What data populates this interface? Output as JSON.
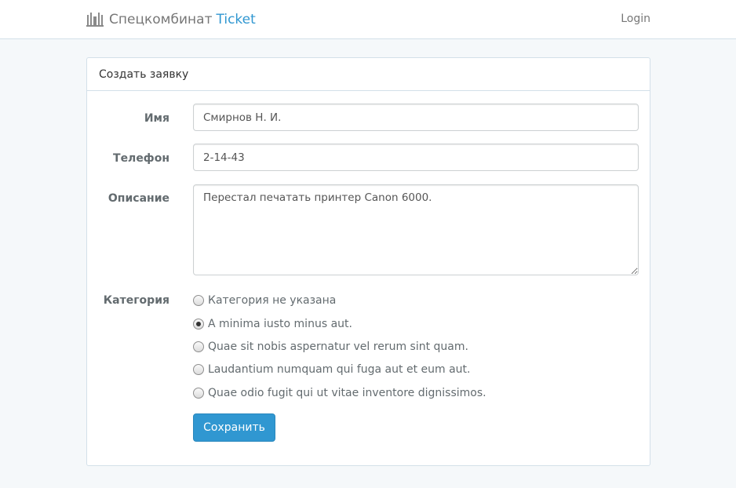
{
  "navbar": {
    "brand_name": "Спецкомбинат",
    "brand_accent": "Ticket",
    "logo_icon": "building-columns-icon",
    "login_label": "Login"
  },
  "panel": {
    "heading": "Создать заявку"
  },
  "form": {
    "name": {
      "label": "Имя",
      "value": "Смирнов Н. И."
    },
    "phone": {
      "label": "Телефон",
      "value": "2-14-43"
    },
    "description": {
      "label": "Описание",
      "value": "Перестал печатать принтер Canon 6000."
    },
    "category": {
      "label": "Категория",
      "options": [
        {
          "label": "Категория не указана",
          "checked": false
        },
        {
          "label": "A minima iusto minus aut.",
          "checked": true
        },
        {
          "label": "Quae sit nobis aspernatur vel rerum sint quam.",
          "checked": false
        },
        {
          "label": "Laudantium numquam qui fuga aut et eum aut.",
          "checked": false
        },
        {
          "label": "Quae odio fugit qui ut vitae inventore dignissimos.",
          "checked": false
        }
      ]
    },
    "submit_label": "Сохранить"
  },
  "colors": {
    "accent": "#3097d1",
    "page_background": "#f5f8fa",
    "border": "#d3e0e9"
  }
}
